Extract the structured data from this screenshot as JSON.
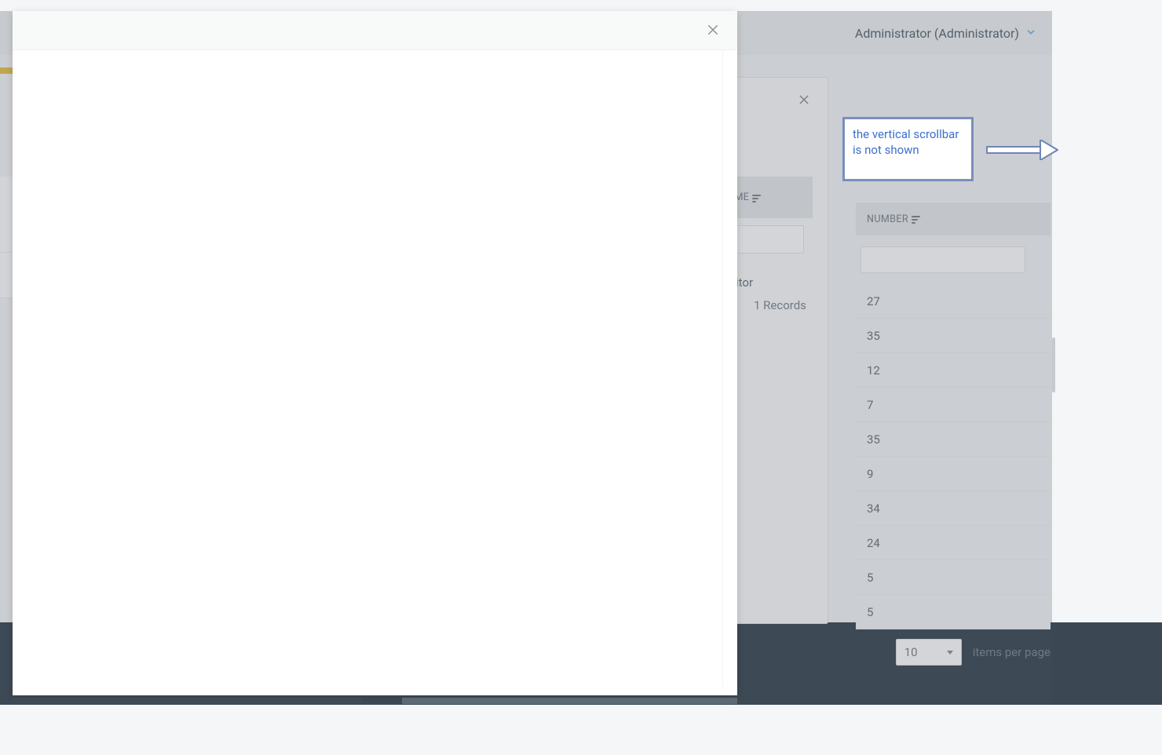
{
  "header": {
    "user_display": "Administrator (Administrator)"
  },
  "bg_panel": {
    "column_label": "AME",
    "cell_value_fragment": "itor",
    "records_text": "1 Records"
  },
  "right_table": {
    "column_label": "NUMBER",
    "values": [
      "27",
      "35",
      "12",
      "7",
      "35",
      "9",
      "34",
      "24",
      "5",
      "5"
    ],
    "page_size": "10",
    "items_per_page_label": "items per page"
  },
  "annotation": {
    "text": "the vertical scrollbar is not shown"
  }
}
